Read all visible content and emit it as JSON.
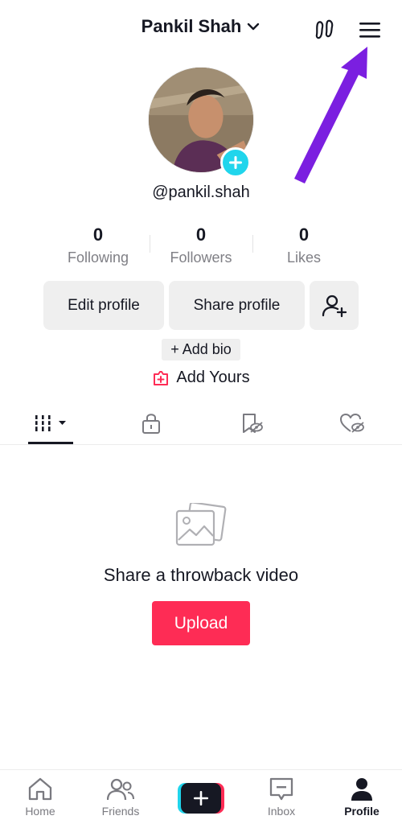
{
  "header": {
    "username": "Pankil Shah",
    "chevron_icon": "chevron-down-icon",
    "footprint_icon": "footprint-icon",
    "menu_icon": "hamburger-menu-icon"
  },
  "annotation": {
    "color": "#7b1fe0"
  },
  "profile": {
    "handle": "@pankil.shah",
    "add_avatar_icon": "plus-icon"
  },
  "stats": [
    {
      "value": "0",
      "label": "Following"
    },
    {
      "value": "0",
      "label": "Followers"
    },
    {
      "value": "0",
      "label": "Likes"
    }
  ],
  "buttons": {
    "edit_profile": "Edit profile",
    "share_profile": "Share profile",
    "add_friend_icon": "add-user-icon",
    "add_bio": "+ Add bio",
    "add_yours": "Add Yours"
  },
  "tabs": [
    {
      "icon": "videos-grid-icon",
      "active": true
    },
    {
      "icon": "lock-icon",
      "active": false
    },
    {
      "icon": "hidden-bookmark-icon",
      "active": false
    },
    {
      "icon": "hidden-heart-icon",
      "active": false
    }
  ],
  "empty_state": {
    "icon": "photos-icon",
    "message": "Share a throwback video",
    "upload_label": "Upload"
  },
  "bottom_nav": {
    "home": "Home",
    "friends": "Friends",
    "create_icon": "plus-icon",
    "inbox": "Inbox",
    "profile": "Profile",
    "active": "Profile"
  },
  "colors": {
    "accent": "#fe2c55",
    "cyan": "#20d5ec",
    "text": "#161823",
    "muted": "#7f7f85",
    "button_bg": "#efefef"
  }
}
